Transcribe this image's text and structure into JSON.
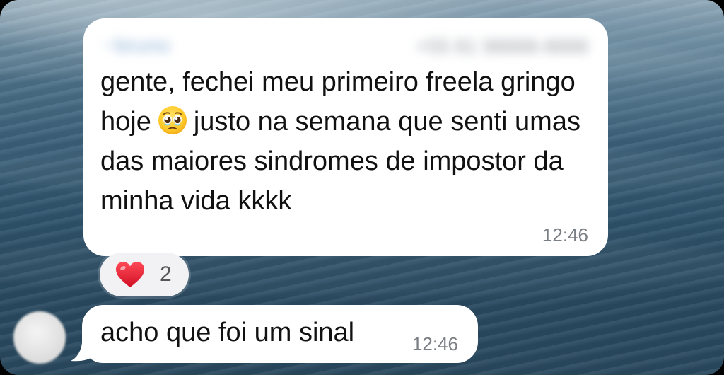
{
  "chat": {
    "message1": {
      "sender_name": "~bruno",
      "sender_meta": "+55 81 98888-8888",
      "text_before_emoji": "gente, fechei meu primeiro freela gringo hoje",
      "emoji": "pleading-face",
      "text_after_emoji": "justo na semana que senti umas das maiores sindromes de impostor da minha vida kkkk",
      "time": "12:46",
      "reaction": {
        "icon": "red-heart",
        "count": "2"
      }
    },
    "message2": {
      "text": "acho que foi um sinal",
      "time": "12:46"
    }
  },
  "colors": {
    "bubble": "#ffffff",
    "text": "#111111",
    "time": "#7a7f85",
    "heart": "#e0182d"
  }
}
